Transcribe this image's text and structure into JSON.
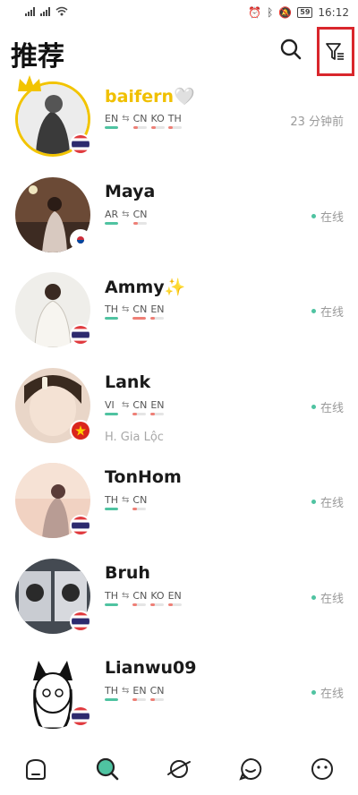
{
  "status_bar": {
    "time": "16:12",
    "battery": "59",
    "network": "4G"
  },
  "header": {
    "title": "推荐"
  },
  "users": [
    {
      "name": "baifern",
      "emoji": "🤍",
      "langs_native": [
        "EN"
      ],
      "langs_learn": [
        "CN",
        "KO",
        "TH"
      ],
      "status": "23 分钟前",
      "online": false,
      "flag": "TH",
      "vip": true,
      "subtitle": ""
    },
    {
      "name": "Maya",
      "emoji": "",
      "langs_native": [
        "AR"
      ],
      "langs_learn": [
        "CN"
      ],
      "status": "在线",
      "online": true,
      "flag": "KR",
      "vip": false,
      "subtitle": ""
    },
    {
      "name": "Ammy",
      "emoji": "✨",
      "langs_native": [
        "TH"
      ],
      "langs_learn": [
        "CN",
        "EN"
      ],
      "status": "在线",
      "online": true,
      "flag": "TH",
      "vip": false,
      "subtitle": ""
    },
    {
      "name": "Lank",
      "emoji": "",
      "langs_native": [
        "VI"
      ],
      "langs_learn": [
        "CN",
        "EN"
      ],
      "status": "在线",
      "online": true,
      "flag": "VN",
      "vip": false,
      "subtitle": "H. Gia Lộc"
    },
    {
      "name": "TonHom",
      "emoji": "",
      "langs_native": [
        "TH"
      ],
      "langs_learn": [
        "CN"
      ],
      "status": "在线",
      "online": true,
      "flag": "TH",
      "vip": false,
      "subtitle": ""
    },
    {
      "name": "Bruh",
      "emoji": "",
      "langs_native": [
        "TH"
      ],
      "langs_learn": [
        "CN",
        "KO",
        "EN"
      ],
      "status": "在线",
      "online": true,
      "flag": "TH",
      "vip": false,
      "subtitle": ""
    },
    {
      "name": "Lianwu09",
      "emoji": "",
      "langs_native": [
        "TH"
      ],
      "langs_learn": [
        "EN",
        "CN"
      ],
      "status": "在线",
      "online": true,
      "flag": "TH",
      "vip": false,
      "subtitle": ""
    }
  ],
  "colors": {
    "accent": "#4fc3a1",
    "learn": "#ef7f76",
    "gold": "#f2c400",
    "highlight": "#d9262c"
  },
  "icons": {
    "header": [
      "search-icon",
      "filter-icon"
    ],
    "bottom_nav": [
      "home-icon",
      "discover-icon",
      "planet-icon",
      "chat-icon",
      "profile-icon"
    ]
  }
}
